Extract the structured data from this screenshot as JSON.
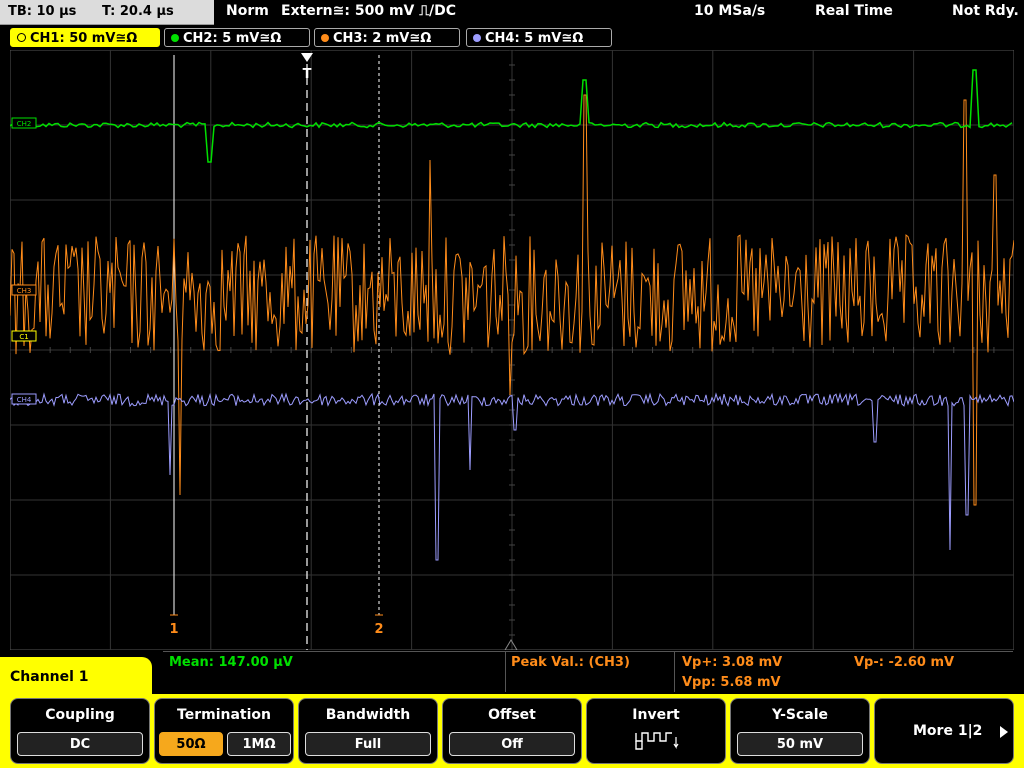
{
  "topbar": {
    "tb_label": "TB: 10 µs",
    "t_label": "T: 20.4 µs",
    "trigger_mode": "Norm",
    "trigger_source": "Extern≅: 500 mV ⎍/DC",
    "sample_rate": "10 MSa/s",
    "acq_mode": "Real Time",
    "status": "Not Rdy."
  },
  "channels": [
    {
      "label": "CH1: 50 mV≅Ω",
      "color": "#ffff00"
    },
    {
      "label": "CH2: 5 mV≅Ω",
      "color": "#00e000"
    },
    {
      "label": "CH3: 2 mV≅Ω",
      "color": "#ff8c1a"
    },
    {
      "label": "CH4: 5 mV≅Ω",
      "color": "#9d9dff"
    }
  ],
  "markers": {
    "trigger": "T",
    "cursor1": "1",
    "cursor2": "2",
    "ch_tags": [
      "CH2",
      "CH3",
      "C1",
      "CH4"
    ]
  },
  "measurements": {
    "mean": "Mean: 147.00 µV",
    "peak": "Peak Val.:  (CH3)",
    "vp_plus": "Vp+: 3.08 mV",
    "vp_minus": "Vp-: -2.60 mV",
    "vpp": "Vpp: 5.68 mV"
  },
  "channel_label": "Channel 1",
  "softkeys": {
    "coupling": {
      "title": "Coupling",
      "value": "DC"
    },
    "termination": {
      "title": "Termination",
      "value_a": "50Ω",
      "value_b": "1MΩ"
    },
    "bandwidth": {
      "title": "Bandwidth",
      "value": "Full"
    },
    "offset": {
      "title": "Offset",
      "value": "Off"
    },
    "invert": {
      "title": "Invert",
      "icon": "invert-wave-icon"
    },
    "yscale": {
      "title": "Y-Scale",
      "value": "50 mV"
    },
    "more": {
      "title": "More 1|2",
      "icon": "arrow-right-icon"
    }
  }
}
